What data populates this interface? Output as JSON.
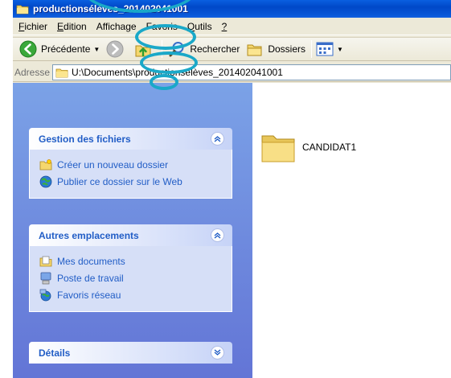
{
  "window": {
    "title": "productionsélèves_201402041001"
  },
  "menubar": {
    "items": [
      {
        "accel": "F",
        "rest": "ichier"
      },
      {
        "accel": "E",
        "rest": "dition"
      },
      {
        "accel": "",
        "rest": "Affichage"
      },
      {
        "accel": "",
        "rest": "Favoris"
      },
      {
        "accel": "O",
        "rest": "utils"
      },
      {
        "accel": "?",
        "rest": ""
      }
    ]
  },
  "toolbar": {
    "back_label": "Précédente",
    "search_label": "Rechercher",
    "folders_label": "Dossiers"
  },
  "addressbar": {
    "label": "Adresse",
    "path": "U:\\Documents\\productionsélèves_201402041001"
  },
  "tasks": {
    "file_tasks": {
      "title": "Gestion des fichiers",
      "items": [
        {
          "label": "Créer un nouveau dossier",
          "icon": "new-folder-icon"
        },
        {
          "label": "Publier ce dossier sur le Web",
          "icon": "globe-icon"
        }
      ]
    },
    "other_places": {
      "title": "Autres emplacements",
      "items": [
        {
          "label": "Mes documents",
          "icon": "my-documents-icon"
        },
        {
          "label": "Poste de travail",
          "icon": "my-computer-icon"
        },
        {
          "label": "Favoris réseau",
          "icon": "network-places-icon"
        }
      ]
    },
    "details": {
      "title": "Détails"
    }
  },
  "files": [
    {
      "name": "CANDIDAT1",
      "type": "folder"
    }
  ],
  "colors": {
    "titlebar": "#0a5fe0",
    "task_link": "#215dc6",
    "task_pane": "#7ba2e7",
    "annotation": "#1aa8c8"
  }
}
